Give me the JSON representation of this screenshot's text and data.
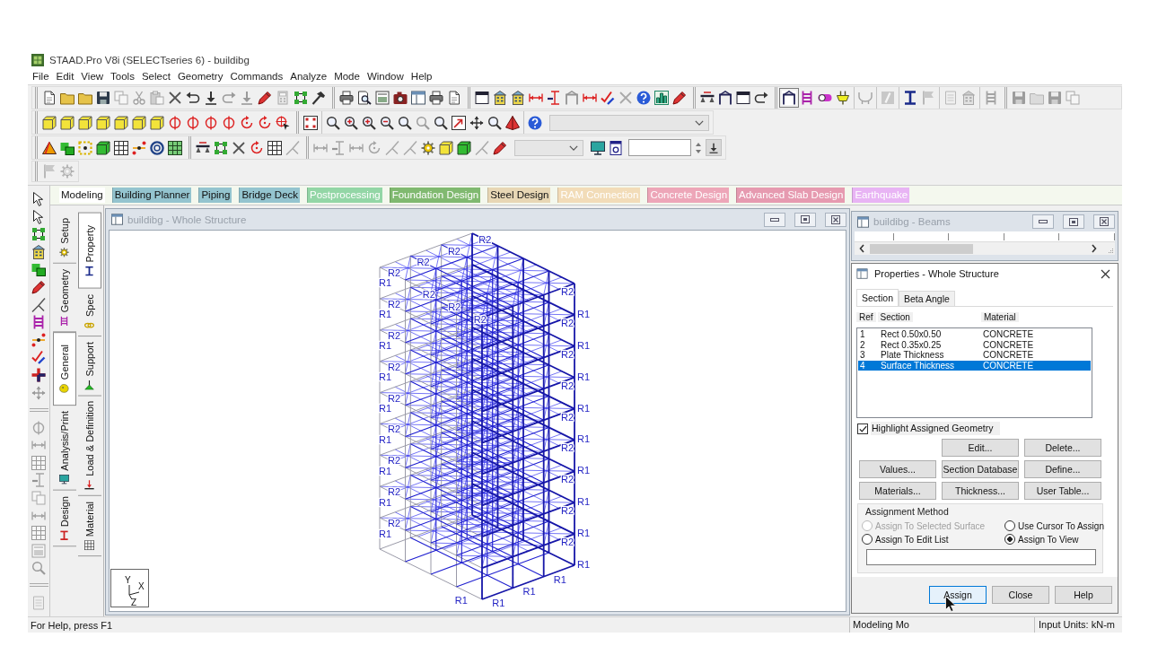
{
  "window": {
    "title": "STAAD.Pro V8i (SELECTseries 6) - buildibg"
  },
  "menu": [
    "File",
    "Edit",
    "View",
    "Tools",
    "Select",
    "Geometry",
    "Commands",
    "Analyze",
    "Mode",
    "Window",
    "Help"
  ],
  "toolbars": [
    [
      [
        {
          "disabled": false
        },
        {
          "disabled": false
        },
        {
          "disabled": false
        },
        {
          "disabled": false
        },
        {
          "disabled": true
        },
        {
          "disabled": true
        },
        {
          "disabled": true
        },
        {
          "disabled": false
        },
        {
          "disabled": false
        },
        {
          "disabled": false
        },
        {
          "disabled": true
        },
        {
          "disabled": true
        },
        {
          "disabled": false
        },
        {
          "disabled": true
        },
        {
          "disabled": false
        },
        {
          "disabled": false
        }
      ],
      [
        {
          "disabled": false
        },
        {
          "disabled": false
        },
        {
          "disabled": false
        },
        {
          "disabled": false
        },
        {
          "disabled": false
        },
        {
          "disabled": false
        },
        {
          "disabled": false
        }
      ],
      [
        {
          "disabled": false
        },
        {
          "disabled": false
        },
        {
          "disabled": false
        },
        {
          "disabled": false
        },
        {
          "disabled": false
        },
        {
          "disabled": true
        },
        {
          "disabled": false
        },
        {
          "disabled": false
        },
        {
          "disabled": true
        },
        {
          "disabled": false
        },
        {
          "disabled": false
        },
        {
          "disabled": false
        }
      ],
      [
        {
          "disabled": false
        },
        {
          "disabled": false
        },
        {
          "disabled": false
        },
        {
          "disabled": false
        }
      ],
      [
        {
          "disabled": false,
          "pressed": true
        },
        {
          "disabled": false,
          "pressed": false
        },
        {
          "disabled": false,
          "pressed": false
        },
        {
          "disabled": false,
          "pressed": false
        }
      ],
      [
        {
          "disabled": true
        }
      ],
      [
        {
          "disabled": true
        }
      ],
      [
        {
          "disabled": false
        },
        {
          "disabled": true
        }
      ],
      [
        {
          "disabled": true
        },
        {
          "disabled": true
        }
      ],
      [
        {
          "disabled": true
        }
      ],
      [
        {
          "disabled": true
        },
        {
          "disabled": true
        },
        {
          "disabled": true
        },
        {
          "disabled": true
        }
      ]
    ],
    [
      [
        {
          "disabled": false
        },
        {
          "disabled": false
        },
        {
          "disabled": false
        },
        {
          "disabled": false
        },
        {
          "disabled": false
        },
        {
          "disabled": false
        },
        {
          "disabled": false
        },
        {
          "disabled": false
        },
        {
          "disabled": false
        },
        {
          "disabled": false
        },
        {
          "disabled": false
        },
        {
          "disabled": false
        },
        {
          "disabled": false
        },
        {
          "disabled": false
        }
      ],
      [
        {
          "disabled": false
        }
      ],
      [
        {
          "disabled": false
        },
        {
          "disabled": false
        },
        {
          "disabled": false
        },
        {
          "disabled": false
        },
        {
          "disabled": false
        },
        {
          "disabled": true
        },
        {
          "disabled": false
        },
        {
          "disabled": false
        },
        {
          "disabled": false
        },
        {
          "disabled": false
        },
        {
          "disabled": false
        }
      ],
      [
        {
          "disabled": false
        }
      ]
    ],
    [
      [
        {
          "disabled": false
        },
        {
          "disabled": false
        },
        {
          "disabled": false
        },
        {
          "disabled": false
        },
        {
          "disabled": false
        },
        {
          "disabled": false
        },
        {
          "disabled": false
        },
        {
          "disabled": false
        }
      ],
      [
        {
          "disabled": false
        },
        {
          "disabled": false
        },
        {
          "disabled": false
        },
        {
          "disabled": false
        },
        {
          "disabled": false
        },
        {
          "disabled": true
        }
      ],
      [
        {
          "disabled": true
        },
        {
          "disabled": true
        },
        {
          "disabled": true
        },
        {
          "disabled": true
        },
        {
          "disabled": true
        },
        {
          "disabled": true
        },
        {
          "disabled": false
        },
        {
          "disabled": false
        },
        {
          "disabled": false
        },
        {
          "disabled": true
        },
        {
          "disabled": false
        }
      ],
      [
        {
          "disabled": false
        },
        {
          "disabled": false
        }
      ]
    ],
    [
      [
        {
          "disabled": true
        },
        {
          "disabled": true
        }
      ]
    ]
  ],
  "left_toolbar": [
    [
      {
        "disabled": false
      },
      {
        "disabled": false
      },
      {
        "disabled": false
      },
      {
        "disabled": false
      },
      {
        "disabled": false
      },
      {
        "disabled": false
      },
      {
        "disabled": false
      },
      {
        "disabled": false
      },
      {
        "disabled": false
      },
      {
        "disabled": false
      },
      {
        "disabled": false
      },
      {
        "disabled": true
      }
    ],
    [
      {
        "disabled": true
      },
      {
        "disabled": true
      },
      {
        "disabled": true
      },
      {
        "disabled": true
      },
      {
        "disabled": true
      },
      {
        "disabled": true
      },
      {
        "disabled": true
      },
      {
        "disabled": true
      },
      {
        "disabled": true
      }
    ],
    [
      {
        "disabled": true
      }
    ]
  ],
  "mode_tabs": [
    {
      "label": "Modeling",
      "selected": true,
      "disabled": false
    },
    {
      "label": "Building Planner",
      "selected": false,
      "disabled": false,
      "color": "#94c4cf"
    },
    {
      "label": "Piping",
      "selected": false,
      "disabled": false,
      "color": "#94c4cf"
    },
    {
      "label": "Bridge Deck",
      "selected": false,
      "disabled": false,
      "color": "#94c4cf"
    },
    {
      "label": "Postprocessing",
      "selected": false,
      "disabled": true,
      "color": "#93d6a6"
    },
    {
      "label": "Foundation Design",
      "selected": false,
      "disabled": true,
      "color": "#80b970"
    },
    {
      "label": "Steel Design",
      "selected": false,
      "disabled": false,
      "color": "#e8d7b5"
    },
    {
      "label": "RAM Connection",
      "selected": false,
      "disabled": true,
      "color": "#f2dcb8"
    },
    {
      "label": "Concrete Design",
      "selected": false,
      "disabled": true,
      "color": "#eda6b8"
    },
    {
      "label": "Advanced Slab Design",
      "selected": false,
      "disabled": true,
      "color": "#e69ab0"
    },
    {
      "label": "Earthquake",
      "selected": false,
      "disabled": true,
      "color": "#e8b4f4"
    }
  ],
  "side_tabs": {
    "left_column": [
      {
        "label": "Setup",
        "selected": false
      },
      {
        "label": "Geometry",
        "selected": false
      },
      {
        "label": "General",
        "selected": true
      },
      {
        "label": "Analysis/Print",
        "selected": false
      },
      {
        "label": "Design",
        "selected": false
      }
    ],
    "right_column": [
      {
        "label": "Property",
        "selected": true
      },
      {
        "label": "Spec",
        "selected": false
      },
      {
        "label": "Support",
        "selected": false
      },
      {
        "label": "Load & Definition",
        "selected": false
      },
      {
        "label": "Material",
        "selected": false
      }
    ]
  },
  "view_window": {
    "title": "buildibg - Whole Structure",
    "structure": {
      "left_column_labels": [
        "R1",
        "R1",
        "R1",
        "R1",
        "R1",
        "R1",
        "R1",
        "R1",
        "R1"
      ],
      "left_beam_labels": [
        "R2",
        "R2",
        "R2",
        "R2",
        "R2",
        "R2",
        "R2",
        "R2",
        "R2"
      ],
      "right_column_labels": [
        "R1",
        "R1",
        "R1",
        "R1",
        "R1",
        "R1",
        "R1",
        "R1",
        "R1"
      ],
      "right_beam_labels": [
        "R2",
        "R2",
        "R2",
        "R2",
        "R2",
        "R2",
        "R2",
        "R2",
        "R2"
      ],
      "roof_labels": [
        "R2",
        "R2",
        "R2",
        "R2",
        "R2",
        "R2"
      ],
      "base_labels": [
        "R1",
        "R1",
        "R1",
        "R1"
      ]
    },
    "axes": [
      "Y",
      "X",
      "Z"
    ]
  },
  "beams_window": {
    "title": "buildibg - Beams"
  },
  "properties": {
    "title": "Properties - Whole Structure",
    "tabs": [
      {
        "label": "Section",
        "selected": true
      },
      {
        "label": "Beta Angle",
        "selected": false
      }
    ],
    "columns": [
      "Ref",
      "Section",
      "Material"
    ],
    "rows": [
      {
        "ref": "1",
        "section": "Rect 0.50x0.50",
        "material": "CONCRETE",
        "selected": false
      },
      {
        "ref": "2",
        "section": "Rect 0.35x0.25",
        "material": "CONCRETE",
        "selected": false
      },
      {
        "ref": "3",
        "section": "Plate Thickness",
        "material": "CONCRETE",
        "selected": false
      },
      {
        "ref": "4",
        "section": "Surface Thickness",
        "material": "CONCRETE",
        "selected": true
      }
    ],
    "highlight": {
      "label": "Highlight Assigned Geometry",
      "checked": true
    },
    "buttons": [
      "Edit...",
      "Delete...",
      "Values...",
      "Section Database",
      "Define...",
      "Materials...",
      "Thickness...",
      "User Table..."
    ],
    "assignment": {
      "title": "Assignment Method",
      "options": [
        {
          "label": "Assign To Selected Surface",
          "selected": false,
          "disabled": true
        },
        {
          "label": "Use Cursor To Assign",
          "selected": false,
          "disabled": false
        },
        {
          "label": "Assign To Edit List",
          "selected": false,
          "disabled": false
        },
        {
          "label": "Assign To View",
          "selected": true,
          "disabled": false
        }
      ]
    },
    "footer_buttons": [
      {
        "label": "Assign",
        "focused": true
      },
      {
        "label": "Close",
        "focused": false
      },
      {
        "label": "Help",
        "focused": false
      }
    ]
  },
  "status_bar": {
    "help": "For Help, press F1",
    "mode": "Modeling Mo",
    "units": "Input Units: kN-m"
  }
}
